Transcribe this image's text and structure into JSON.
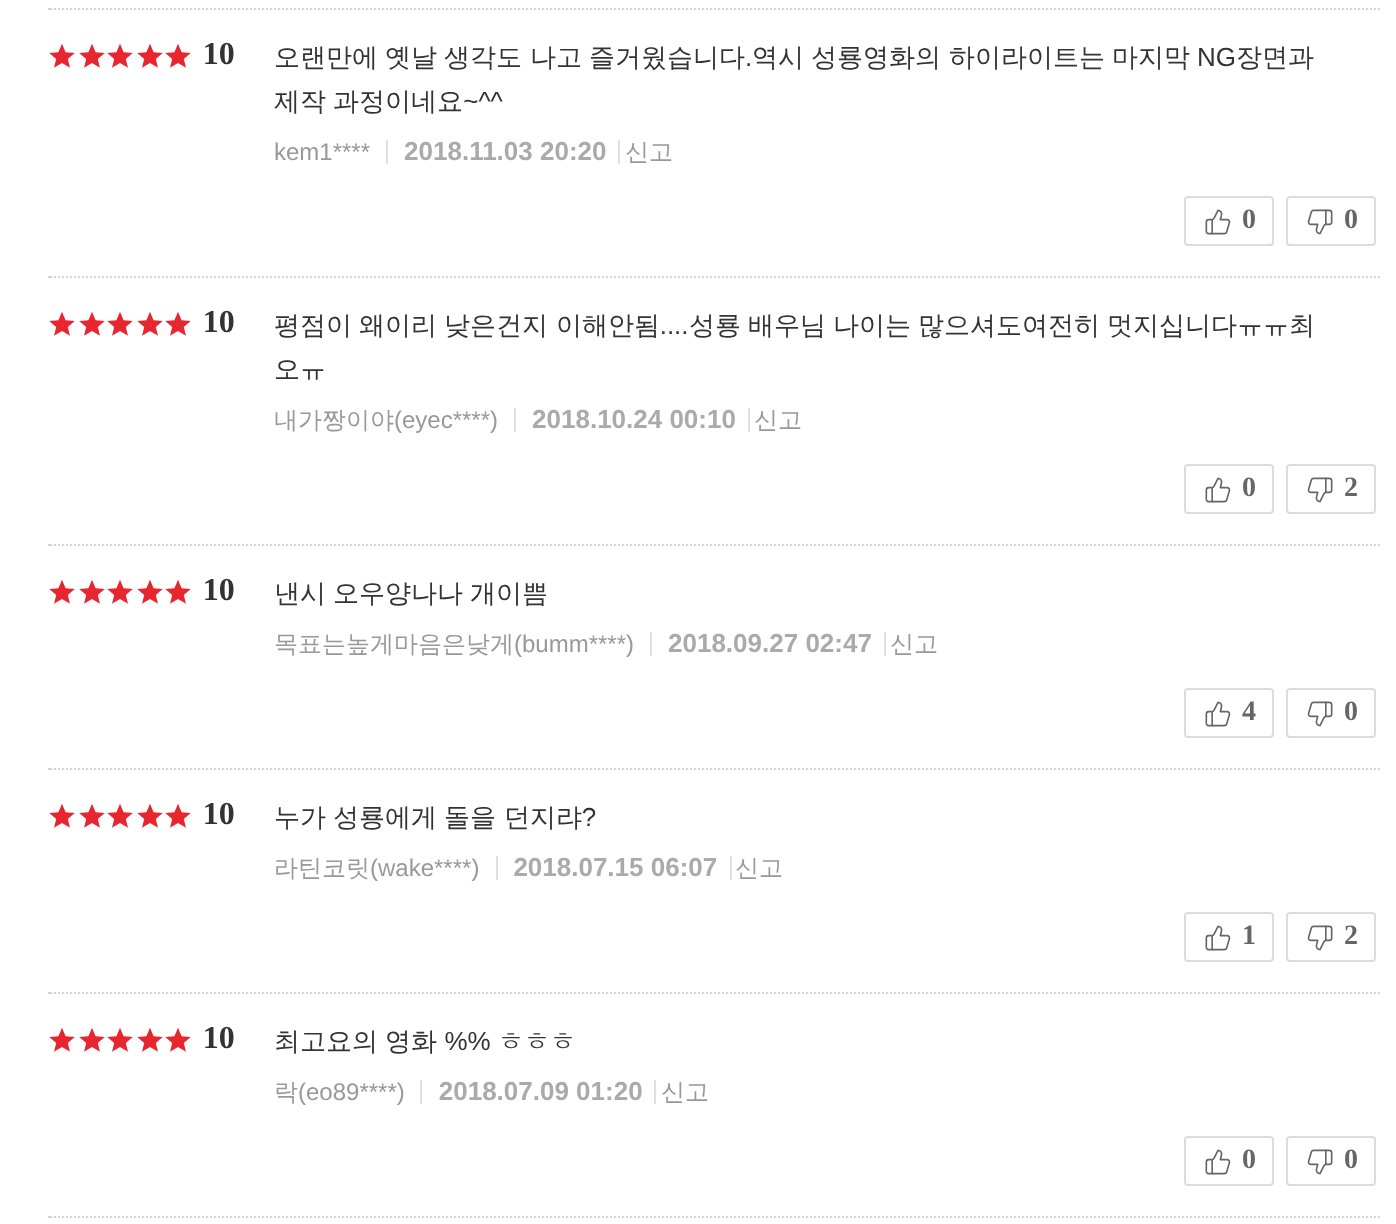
{
  "reviews": [
    {
      "stars": 5,
      "score": "10",
      "text": "오랜만에 옛날 생각도 나고 즐거웠습니다.역시 성룡영화의 하이라이트는 마지막 NG장면과 제작 과정이네요~^^",
      "nickname": "kem1****",
      "date": "2018.11.03 20:20",
      "report": "신고",
      "likes": "0",
      "dislikes": "0"
    },
    {
      "stars": 5,
      "score": "10",
      "text": "평점이 왜이리 낮은건지 이해안됨....성룡 배우님 나이는 많으셔도여전히 멋지십니다ㅠㅠ최오ㅠ",
      "nickname": "내가짱이야(eyec****)",
      "date": "2018.10.24 00:10",
      "report": "신고",
      "likes": "0",
      "dislikes": "2"
    },
    {
      "stars": 5,
      "score": "10",
      "text": "낸시 오우양나나 개이쁨",
      "nickname": "목표는높게마음은낮게(bumm****)",
      "date": "2018.09.27 02:47",
      "report": "신고",
      "likes": "4",
      "dislikes": "0"
    },
    {
      "stars": 5,
      "score": "10",
      "text": "누가 성룡에게 돌을 던지랴?",
      "nickname": "라틴코릿(wake****)",
      "date": "2018.07.15 06:07",
      "report": "신고",
      "likes": "1",
      "dislikes": "2"
    },
    {
      "stars": 5,
      "score": "10",
      "text": "최고요의 영화 %% ㅎㅎㅎ",
      "nickname": "락(eo89****)",
      "date": "2018.07.09 01:20",
      "report": "신고",
      "likes": "0",
      "dislikes": "0"
    }
  ]
}
